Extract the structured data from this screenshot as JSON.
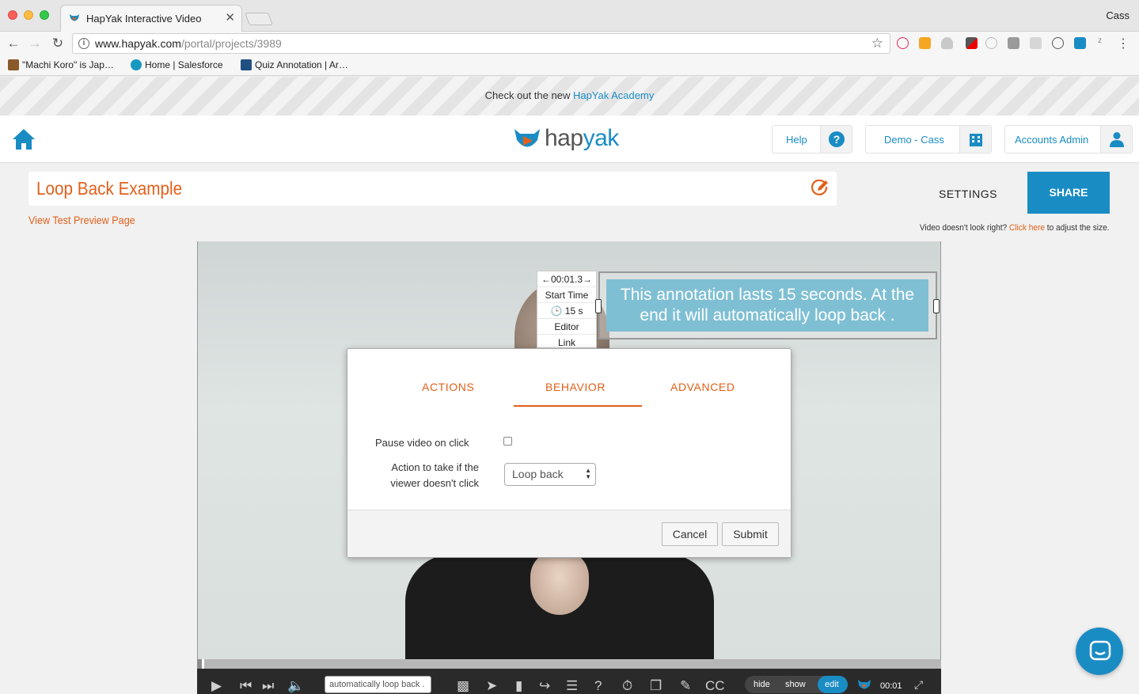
{
  "browser": {
    "tab_title": "HapYak Interactive Video",
    "tab_close": "✕",
    "user": "Cass",
    "url_host": "www.hapyak.com",
    "url_path": "/portal/projects/3989",
    "info_glyph": "i",
    "bookmarks": [
      {
        "label": "\"Machi Koro\" is Jap…",
        "icon": "image-icon",
        "color": "#8b5a2b"
      },
      {
        "label": "Home | Salesforce",
        "icon": "salesforce-cloud-icon",
        "color": "#1798c1"
      },
      {
        "label": "Quiz Annotation | Ar…",
        "icon": "atlassian-icon",
        "color": "#205081"
      }
    ],
    "extension_letter_z": "z"
  },
  "banner": {
    "text": "Check out the new ",
    "link": "HapYak Academy"
  },
  "header": {
    "logo_prefix": "hap",
    "logo_suffix": "yak",
    "help_label": "Help",
    "account_label": "Demo - Cass",
    "admin_label": "Accounts Admin"
  },
  "project": {
    "title": "Loop Back Example",
    "preview_link": "View Test Preview Page",
    "settings_label": "SETTINGS",
    "share_label": "SHARE",
    "adjust_prefix": "Video doesn't look right? ",
    "adjust_link": "Click here",
    "adjust_suffix": " to adjust the size."
  },
  "annotation": {
    "menu": [
      "←00:01.3→",
      "Start Time",
      "15 s",
      "Editor",
      "Link"
    ],
    "text": "This annotation lasts 15 seconds.  At the end it will automatically loop back ."
  },
  "modal": {
    "tabs": [
      "ACTIONS",
      "BEHAVIOR",
      "ADVANCED"
    ],
    "active_tab": "BEHAVIOR",
    "pause_label": "Pause video on click",
    "pause_checked": false,
    "action_label_line1": "Action to take if the",
    "action_label_line2": "viewer doesn't click",
    "action_value": "Loop back",
    "cancel_label": "Cancel",
    "submit_label": "Submit"
  },
  "player": {
    "annotation_field": "automatically loop back .",
    "hide_label": "hide",
    "show_label": "show",
    "edit_label": "edit",
    "time": "00:01",
    "progress": 0.007,
    "cc_label": "CC"
  },
  "colors": {
    "accent_orange": "#e2601a",
    "brand_blue": "#1a8cc4",
    "annotation_blue": "#7fbfd4"
  }
}
